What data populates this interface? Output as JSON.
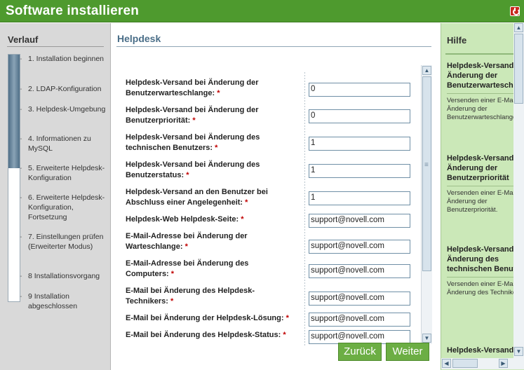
{
  "window": {
    "title": "Software installieren"
  },
  "sidebar": {
    "title": "Verlauf",
    "progress": 0.46,
    "steps": [
      {
        "label": "1. Installation beginnen"
      },
      {
        "label": "2. LDAP-Konfiguration"
      },
      {
        "label": "3. Helpdesk-Umgebung"
      },
      {
        "label": "4. Informationen zu MySQL"
      },
      {
        "label": "5. Erweiterte Helpdesk-Konfiguration"
      },
      {
        "label": "6. Erweiterte Helpdesk-Konfiguration, Fortsetzung"
      },
      {
        "label": "7. Einstellungen prüfen (Erweiterter Modus)"
      },
      {
        "label": "8 Installationsvorgang"
      },
      {
        "label": "9 Installation abgeschlossen"
      }
    ]
  },
  "main": {
    "title": "Helpdesk",
    "fields": [
      {
        "label": "Helpdesk-Versand bei Änderung der Benutzerwarteschlange:",
        "value": "0"
      },
      {
        "label": "Helpdesk-Versand bei Änderung der Benutzerpriorität:",
        "value": "0"
      },
      {
        "label": "Helpdesk-Versand bei Änderung des technischen Benutzers:",
        "value": "1"
      },
      {
        "label": "Helpdesk-Versand bei Änderung des Benutzerstatus:",
        "value": "1"
      },
      {
        "label": "Helpdesk-Versand an den Benutzer bei Abschluss einer Angelegenheit:",
        "value": "1"
      },
      {
        "label": "Helpdesk-Web Helpdesk-Seite:",
        "value": "support@novell.com"
      },
      {
        "label": "E-Mail-Adresse bei Änderung der Warteschlange:",
        "value": "support@novell.com"
      },
      {
        "label": "E-Mail-Adresse bei Änderung des Computers:",
        "value": "support@novell.com"
      },
      {
        "label": "E-Mail bei Änderung des Helpdesk-Technikers:",
        "value": "support@novell.com"
      },
      {
        "label": "E-Mail bei Änderung der Helpdesk-Lösung:",
        "value": "support@novell.com"
      },
      {
        "label": "E-Mail bei Änderung des Helpdesk-Status:",
        "value": "support@novell.com"
      }
    ],
    "required_marker": "*",
    "buttons": {
      "back": "Zurück",
      "next": "Weiter"
    }
  },
  "help": {
    "title": "Hilfe",
    "items": [
      {
        "title": "Helpdesk-Versand bei Änderung der Benutzerwarteschlange",
        "desc": "Versenden einer E-Mail bei Änderung der Benutzerwarteschlange."
      },
      {
        "title": "Helpdesk-Versand bei Änderung der Benutzerpriorität",
        "desc": "Versenden einer E-Mail bei Änderung der Benutzerpriorität."
      },
      {
        "title": "Helpdesk-Versand bei Änderung des technischen Benutzers",
        "desc": "Versenden einer E-Mail bei Änderung des Technikers."
      },
      {
        "title": "Helpdesk-Versand",
        "desc": ""
      }
    ]
  },
  "colors": {
    "title_bar": "#4e9a2e",
    "help_bg": "#cbe8b8",
    "button": "#6cae44",
    "sidebar_bg": "#d9d9d9",
    "accent_title": "#4a6e88"
  }
}
